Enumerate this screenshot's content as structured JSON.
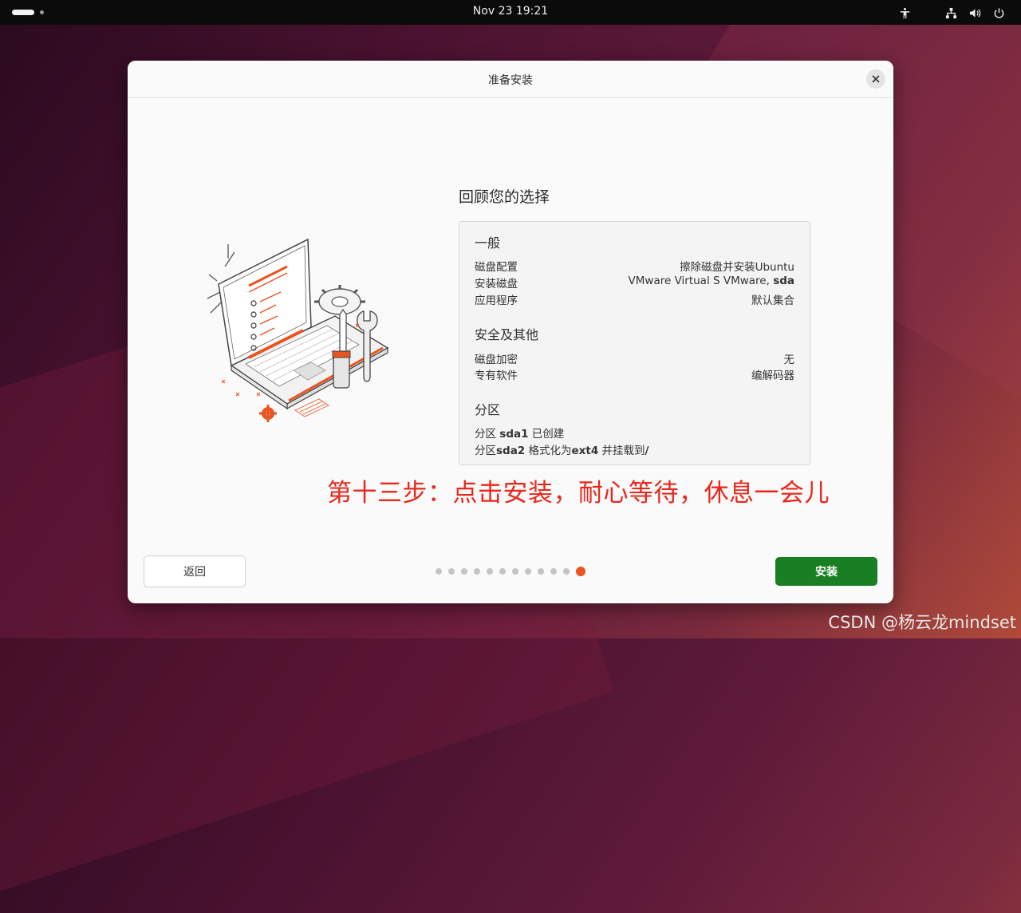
{
  "topbar": {
    "clock": "Nov 23  19:21",
    "icons": [
      "accessibility-icon",
      "network-icon",
      "volume-icon",
      "power-icon"
    ]
  },
  "dialog": {
    "title": "准备安装",
    "review_title": "回顾您的选择",
    "general": {
      "heading": "一般",
      "rows": [
        {
          "key": "磁盘配置",
          "value": "擦除磁盘并安装Ubuntu"
        },
        {
          "key": "安装磁盘",
          "value_prefix": "VMware Virtual S VMware, ",
          "value_bold": "sda"
        },
        {
          "key": "应用程序",
          "value": "默认集合"
        }
      ]
    },
    "security": {
      "heading": "安全及其他",
      "rows": [
        {
          "key": "磁盘加密",
          "value": "无"
        },
        {
          "key": "专有软件",
          "value": "编解码器"
        }
      ]
    },
    "partitions": {
      "heading": "分区",
      "line1": {
        "prefix": "分区 ",
        "bold": "sda1",
        "suffix": " 已创建"
      },
      "line2": {
        "prefix": "分区",
        "bold": "sda2",
        "middle": " 格式化为",
        "bold2": "ext4",
        "middle2": " 并挂载到",
        "bold3": "/"
      }
    },
    "back_label": "返回",
    "install_label": "安装",
    "progress": {
      "total_steps": 12,
      "current_step": 12
    }
  },
  "annotation": "第十三步：点击安装，耐心等待，休息一会儿",
  "watermark": "CSDN @杨云龙mindset",
  "colors": {
    "accent": "#e95420",
    "install": "#1a7f22",
    "annotation": "#e8281c"
  }
}
